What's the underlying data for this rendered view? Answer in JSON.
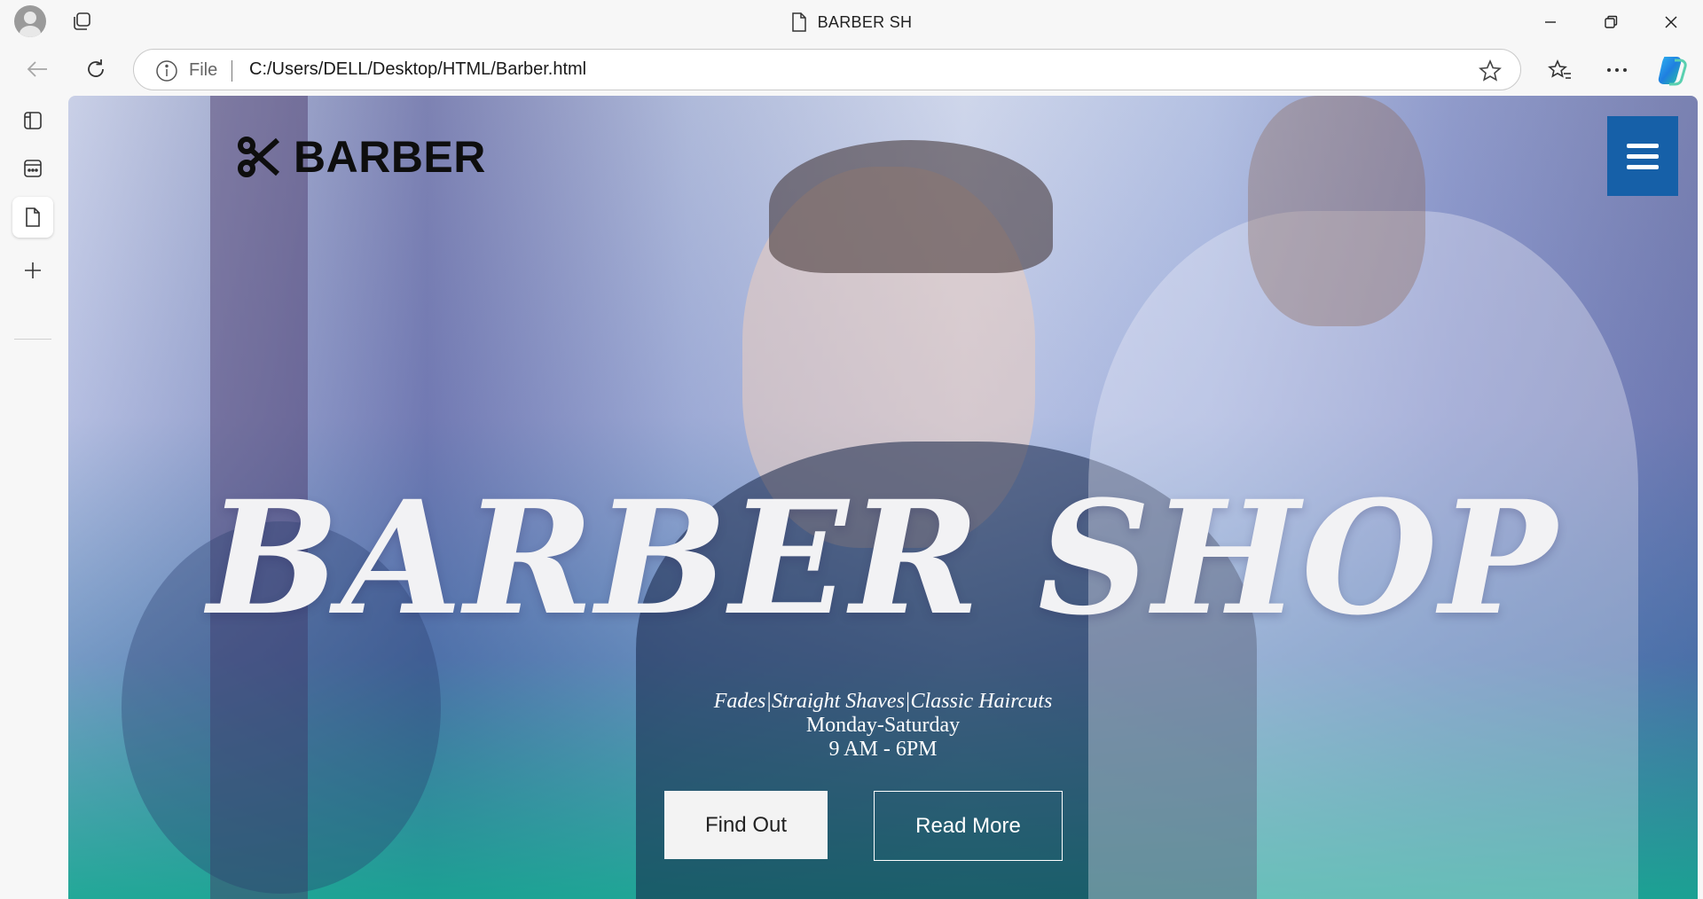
{
  "browser": {
    "window_title": "BARBER SH",
    "address": {
      "protocol_label": "File",
      "url": "C:/Users/DELL/Desktop/HTML/Barber.html"
    },
    "icons": {
      "profile": "profile-avatar-icon",
      "tabs": "tab-actions-icon",
      "page": "document-icon",
      "minimize": "minimize-icon",
      "restore": "restore-icon",
      "close": "close-icon",
      "back": "back-arrow-icon",
      "refresh": "refresh-icon",
      "info": "info-icon",
      "favorite": "star-icon",
      "favorites": "favorites-list-icon",
      "more": "more-dots-icon",
      "copilot": "copilot-icon"
    },
    "sidebar": [
      "vertical-tabs-icon",
      "collections-icon",
      "document-icon",
      "add-icon"
    ]
  },
  "page": {
    "brand_name": "BARBER",
    "hero_title": "BARBER SHOP",
    "tagline": "Fades|Straight Shaves|Classic Haircuts",
    "days": "Monday-Saturday",
    "hours": "9 AM - 6PM",
    "primary_button": "Find Out",
    "secondary_button": "Read More",
    "colors": {
      "menu_button": "#1660a8",
      "gradient_bottom": "#14a591",
      "title_text": "#f2f2f4"
    }
  }
}
